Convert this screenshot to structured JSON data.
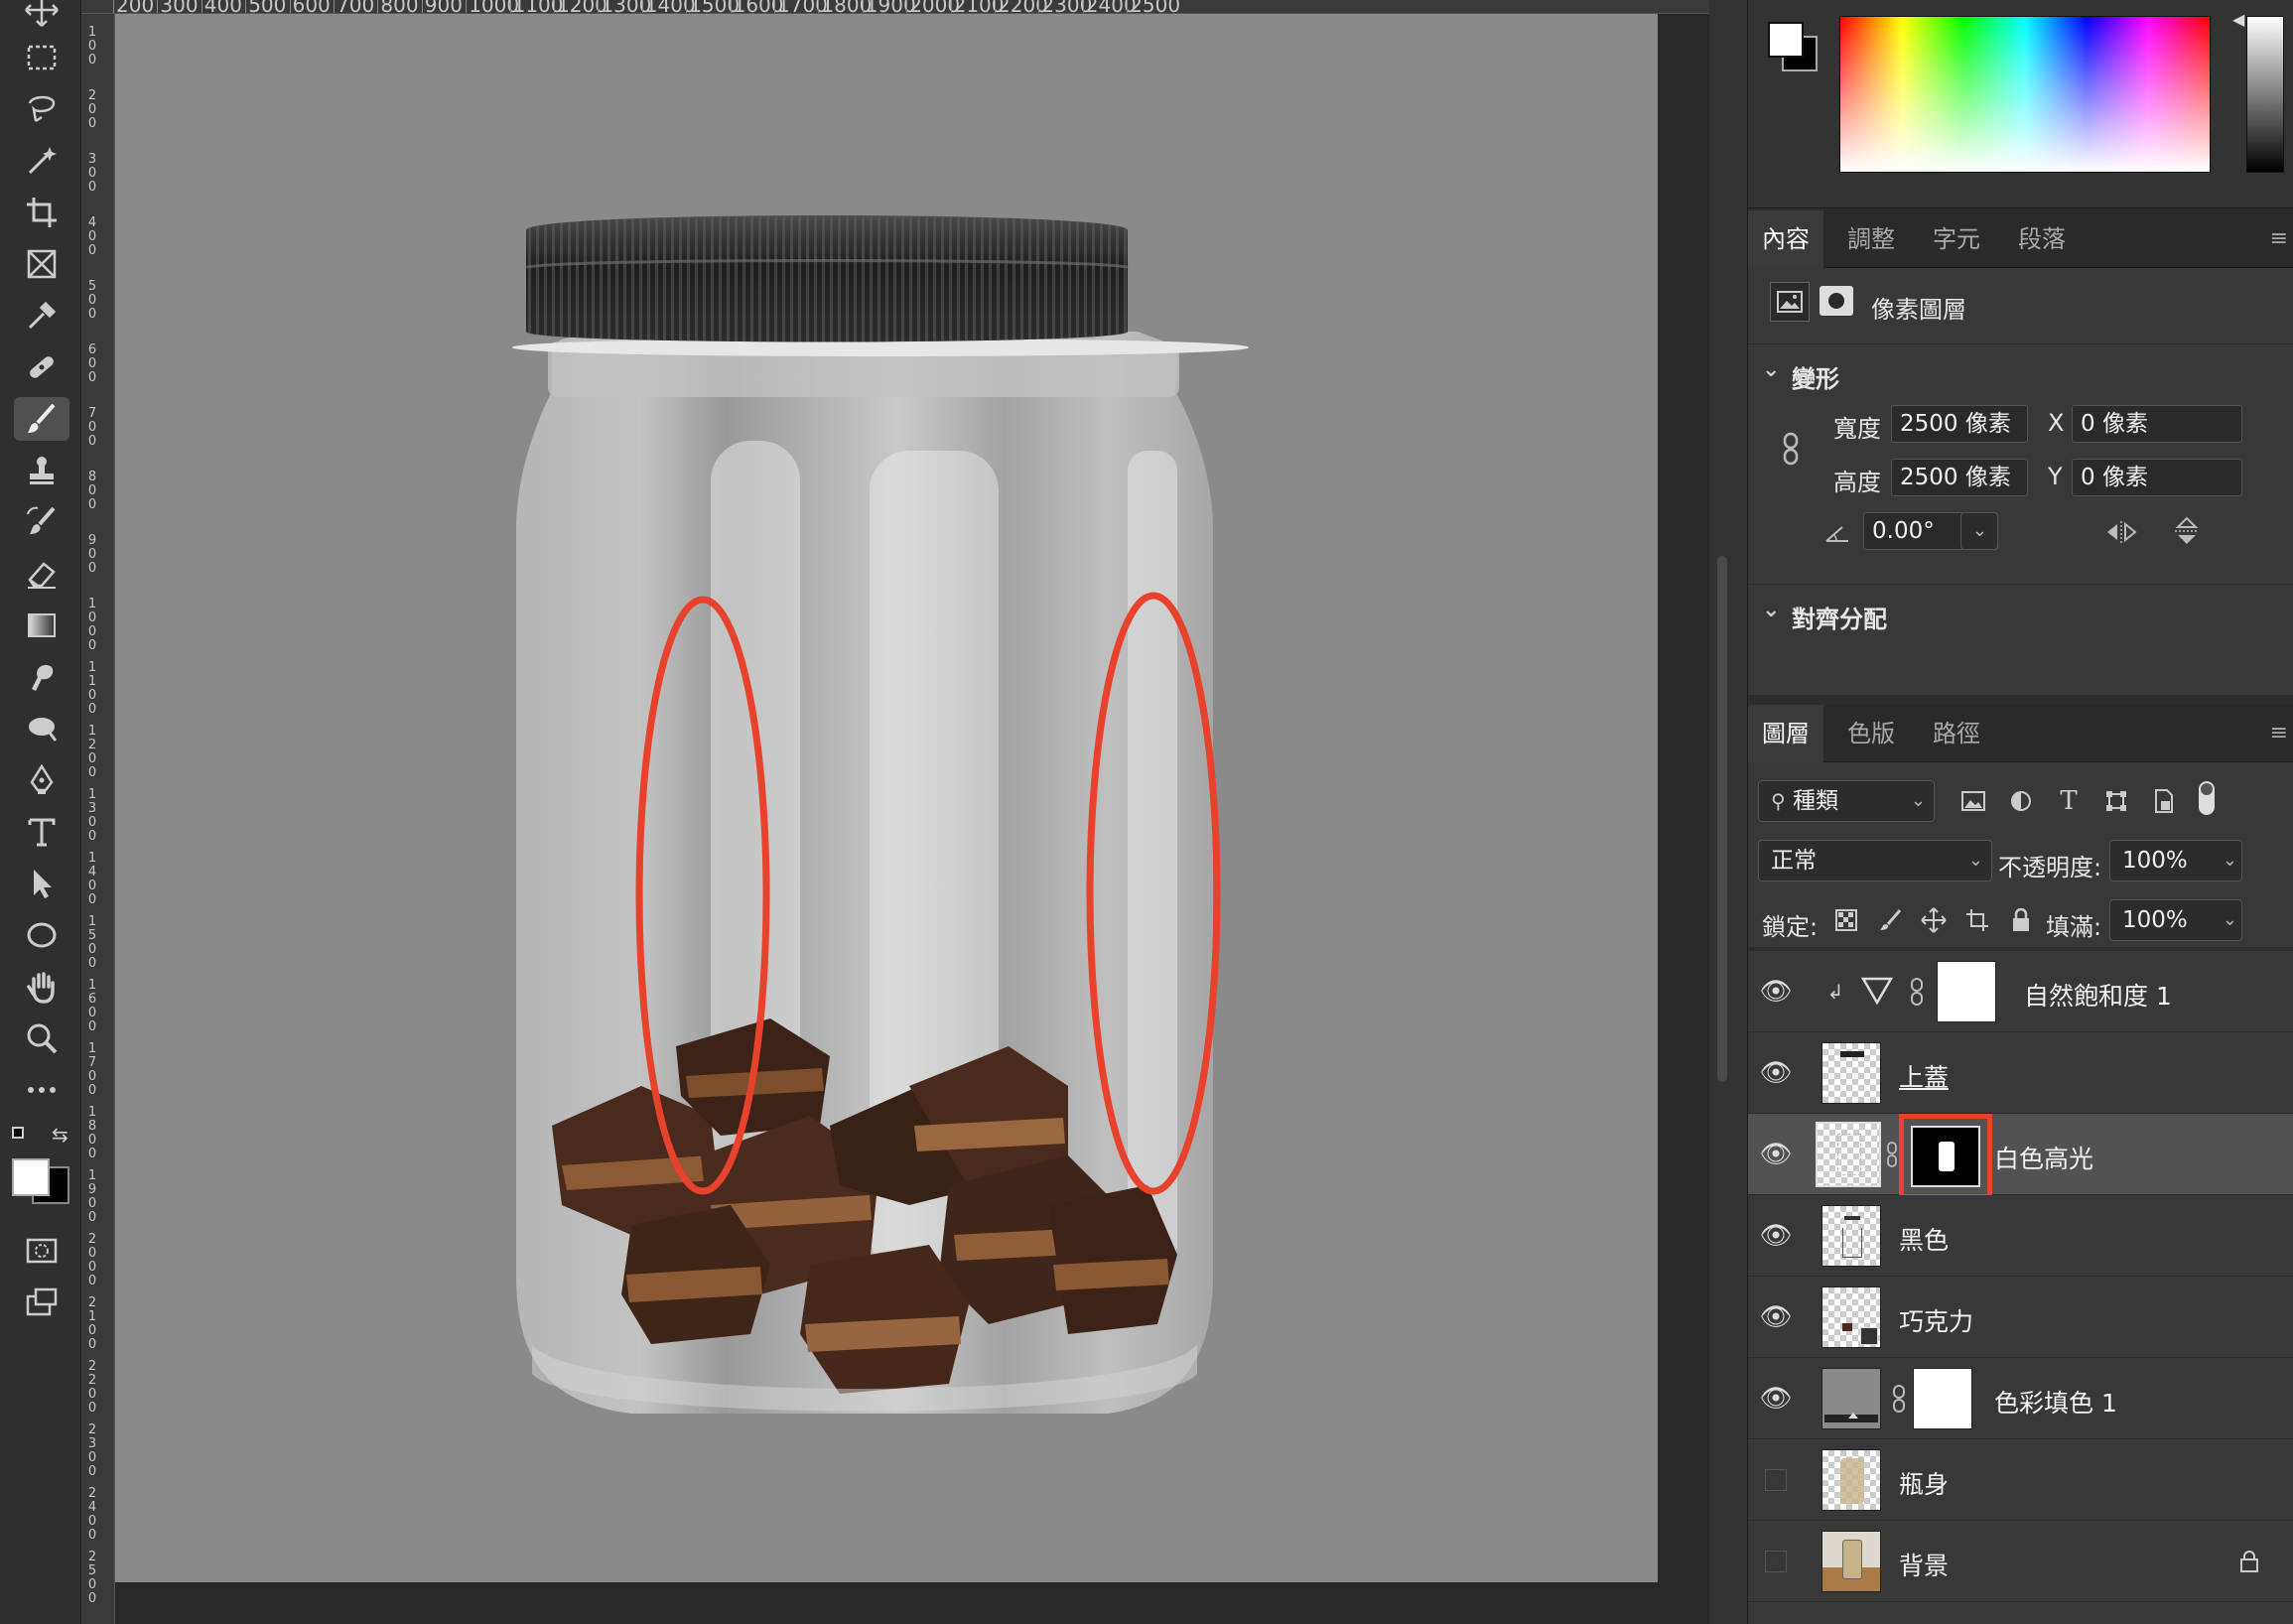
{
  "ruler": {
    "top_ticks": [
      "200",
      "300",
      "400",
      "500",
      "600",
      "700",
      "800",
      "900",
      "1000",
      "1100",
      "1200",
      "1300",
      "1400",
      "1500",
      "1600",
      "1700",
      "1800",
      "1900",
      "2000",
      "2100",
      "2200",
      "2300",
      "2400",
      "2500"
    ],
    "left_ticks": [
      "100",
      "200",
      "300",
      "400",
      "500",
      "600",
      "700",
      "800",
      "900",
      "1000",
      "1100",
      "1200",
      "1300",
      "1400",
      "1500",
      "1600",
      "1700",
      "1800",
      "1900",
      "2000",
      "2100",
      "2200",
      "2300",
      "2400",
      "2500"
    ]
  },
  "toolbar": {
    "tools": [
      "move-tool",
      "rect-marquee-tool",
      "lasso-tool",
      "magic-wand-tool",
      "crop-tool",
      "frame-tool",
      "eyedropper-tool",
      "healing-brush-tool",
      "brush-tool",
      "clone-stamp-tool",
      "history-brush-tool",
      "eraser-tool",
      "gradient-tool",
      "smudge-tool",
      "dodge-tool",
      "pen-tool",
      "type-tool",
      "path-select-tool",
      "ellipse-tool",
      "hand-tool",
      "zoom-tool",
      "more-tools"
    ],
    "active_tool": "brush-tool",
    "foreground_color": "#ffffff",
    "background_color": "#000000"
  },
  "canvas": {
    "background": "#8a8a8a",
    "annotation_color": "#e8412c"
  },
  "color_panel": {
    "fg": "#ffffff",
    "bg": "#000000"
  },
  "properties_panel": {
    "tabs": [
      "內容",
      "調整",
      "字元",
      "段落"
    ],
    "active_tab": "內容",
    "layer_type": "像素圖層",
    "transform": {
      "section_title": "變形",
      "width_label": "寬度",
      "width_value": "2500 像素",
      "height_label": "高度",
      "height_value": "2500 像素",
      "x_label": "X",
      "x_value": "0 像素",
      "y_label": "Y",
      "y_value": "0 像素",
      "angle_value": "0.00°"
    },
    "align": {
      "section_title": "對齊分配"
    }
  },
  "layers_panel": {
    "tabs": [
      "圖層",
      "色版",
      "路徑"
    ],
    "active_tab": "圖層",
    "filter": "種類",
    "blend_mode": "正常",
    "opacity_label": "不透明度:",
    "opacity_value": "100%",
    "lock_label": "鎖定:",
    "fill_label": "填滿:",
    "fill_value": "100%",
    "layers": [
      {
        "name": "自然飽和度 1",
        "visible": true
      },
      {
        "name": "上蓋",
        "visible": true
      },
      {
        "name": "白色高光",
        "visible": true,
        "selected": true
      },
      {
        "name": "黑色",
        "visible": true
      },
      {
        "name": "巧克力",
        "visible": true
      },
      {
        "name": "色彩填色 1",
        "visible": true
      },
      {
        "name": "瓶身",
        "visible": false
      },
      {
        "name": "背景",
        "visible": false,
        "locked": true
      }
    ]
  }
}
